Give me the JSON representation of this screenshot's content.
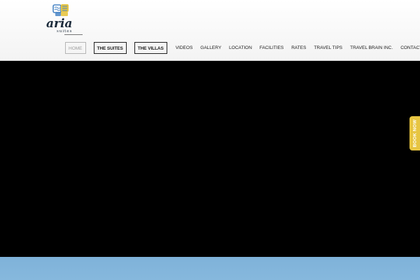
{
  "brand": {
    "name": "aria",
    "tagline": "suites",
    "logo_icon": "aria-suites-logo",
    "colors": {
      "blue": "#4a86c5",
      "yellow": "#e7c542",
      "ink": "#1b2a3a"
    }
  },
  "nav": {
    "items": [
      {
        "label": "HOME",
        "style": "active"
      },
      {
        "label": "THE SUITES",
        "style": "boxed"
      },
      {
        "label": "THE VILLAS",
        "style": "boxed"
      },
      {
        "label": "VIDEOS",
        "style": "plain"
      },
      {
        "label": "GALLERY",
        "style": "plain"
      },
      {
        "label": "LOCATION",
        "style": "plain"
      },
      {
        "label": "FACILITIES",
        "style": "plain"
      },
      {
        "label": "RATES",
        "style": "plain"
      },
      {
        "label": "TRAVEL TIPS",
        "style": "plain"
      },
      {
        "label": "TRAVEL BRAIN INC.",
        "style": "plain"
      },
      {
        "label": "CONTACT",
        "style": "plain"
      }
    ]
  },
  "book_now": {
    "label": "BOOK NOW",
    "color": "#e7c542"
  },
  "hero": {
    "video_background": "#000000",
    "sky_color": "#7fb2d9"
  }
}
